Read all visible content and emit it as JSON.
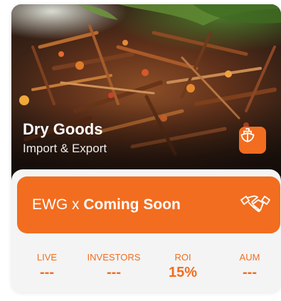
{
  "card": {
    "title": "Dry Goods",
    "subtitle": "Import & Export",
    "badge_icon": "boat-icon",
    "image_icon": "dried-fish-photo"
  },
  "cta": {
    "prefix": "EWG x ",
    "status": "Coming Soon",
    "icon": "handshake-icon"
  },
  "stats": [
    {
      "label": "LIVE",
      "value": "---"
    },
    {
      "label": "INVESTORS",
      "value": "---"
    },
    {
      "label": "ROI",
      "value": "15%"
    },
    {
      "label": "AUM",
      "value": "---"
    }
  ],
  "colors": {
    "accent": "#f26d1f",
    "card_background": "#f4f4f4",
    "text_on_accent": "#ffffff"
  }
}
